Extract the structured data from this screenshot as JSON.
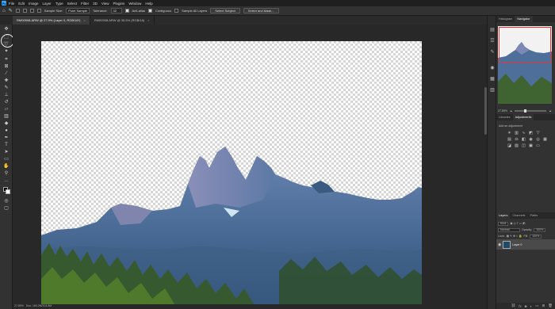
{
  "app": {
    "logo": "Ps"
  },
  "menu": [
    "File",
    "Edit",
    "Image",
    "Layer",
    "Type",
    "Select",
    "Filter",
    "3D",
    "View",
    "Plugins",
    "Window",
    "Help"
  ],
  "options_bar": {
    "sample_size_label": "Sample Size:",
    "sample_size_value": "Point Sample",
    "tolerance_label": "Tolerance:",
    "tolerance_value": "32",
    "anti_alias_label": "Anti-alias",
    "contiguous_label": "Contiguous",
    "sample_all_layers_label": "Sample All Layers",
    "select_subject_label": "Select Subject",
    "select_mask_label": "Select and Mask..."
  },
  "doc_tabs": [
    {
      "label": "RM00908.ARW @ 27.9% (Layer 0, RGB/16*)",
      "active": true
    },
    {
      "label": "RM00908.ARW @ 35.5% (RGB/16)",
      "active": false
    }
  ],
  "tool_flyout": [
    {
      "label": "Object Selection Tool",
      "shortcut": "W"
    },
    {
      "label": "Quick Selection Tool",
      "shortcut": "W"
    },
    {
      "label": "Magic Wand Tool",
      "shortcut": "W"
    }
  ],
  "status": {
    "zoom": "27.89%",
    "info": "Doc: 160.2M/104.8M"
  },
  "navigator": {
    "tabs": [
      "Histogram",
      "Navigator"
    ],
    "active_tab": "Navigator",
    "zoom": "27.89%"
  },
  "adjustments": {
    "tabs": [
      "Libraries",
      "Adjustments"
    ],
    "active_tab": "Adjustments",
    "subtitle": "Add an adjustment"
  },
  "layers": {
    "tabs": [
      "Layers",
      "Channels",
      "Paths"
    ],
    "active_tab": "Layers",
    "filter_label": "Kind",
    "blend_mode": "Normal",
    "opacity_label": "Opacity:",
    "opacity_value": "100%",
    "lock_label": "Lock:",
    "fill_label": "Fill:",
    "fill_value": "100%",
    "layer_name": "Layer 0"
  },
  "icons": {
    "close": "×",
    "eye": "eye-icon"
  }
}
